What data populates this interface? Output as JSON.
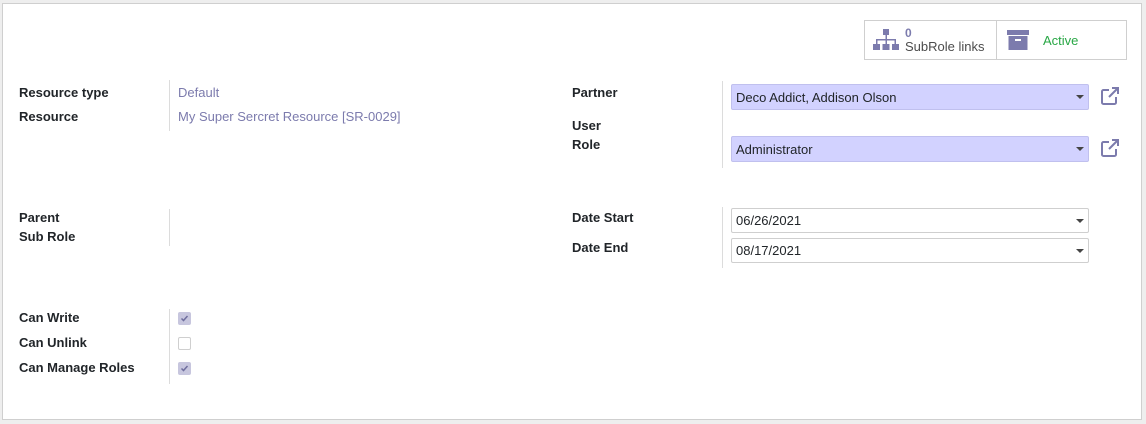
{
  "smart_buttons": {
    "subrole_count": "0",
    "subrole_label": "SubRole links",
    "active_label": "Active"
  },
  "fields": {
    "resource_type": {
      "label": "Resource type",
      "value": "Default"
    },
    "resource": {
      "label": "Resource",
      "value": "My Super Sercret Resource [SR-0029]"
    },
    "partner": {
      "label": "Partner",
      "value": "Deco Addict, Addison Olson"
    },
    "user": {
      "label": "User"
    },
    "role": {
      "label": "Role",
      "value": "Administrator"
    },
    "parent": {
      "label": "Parent"
    },
    "sub_role": {
      "label": "Sub Role"
    },
    "date_start": {
      "label": "Date Start",
      "value": "06/26/2021"
    },
    "date_end": {
      "label": "Date End",
      "value": "08/17/2021"
    },
    "can_write": {
      "label": "Can Write",
      "checked": true
    },
    "can_unlink": {
      "label": "Can Unlink",
      "checked": false
    },
    "can_manage_roles": {
      "label": "Can Manage Roles",
      "checked": true
    }
  },
  "colors": {
    "accent": "#7c7bad",
    "required_bg": "#d2d2ff",
    "active": "#28a745"
  },
  "icons": {
    "subrole": "sitemap-icon",
    "active": "archive-icon",
    "external": "external-link-icon",
    "dropdown": "caret-down-icon",
    "check": "check-icon"
  }
}
